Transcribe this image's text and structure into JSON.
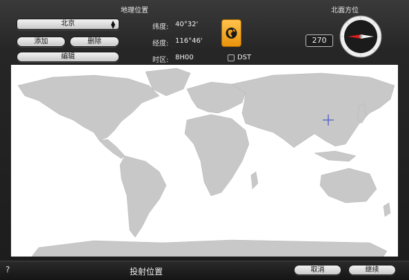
{
  "location": {
    "section_title": "地理位置",
    "city_value": "北京",
    "add_label": "添加",
    "delete_label": "删除",
    "edit_label": "编辑",
    "latitude_label": "纬度:",
    "latitude_value": "40°32'",
    "longitude_label": "经度:",
    "longitude_value": "116°46'",
    "timezone_label": "时区:",
    "timezone_value": "8H00",
    "dst_label": "DST",
    "dst_checked": false
  },
  "heading": {
    "section_title": "北面方位",
    "value": "270"
  },
  "icons": {
    "globe": "globe-icon",
    "compass": "compass-icon",
    "crosshair": "crosshair-icon",
    "popup_arrows": "updown-arrows-icon",
    "checkbox": "checkbox-icon"
  },
  "map": {
    "marker_lat": 40.53,
    "marker_lon": 116.77
  },
  "footer": {
    "help_label": "?",
    "title": "投射位置",
    "cancel_label": "取消",
    "continue_label": "继续"
  },
  "colors": {
    "accent_orange": "#f0a21a",
    "compass_red": "#d81e1e",
    "land_gray": "#c8c8c8",
    "crosshair_blue": "#2a3fc9"
  }
}
